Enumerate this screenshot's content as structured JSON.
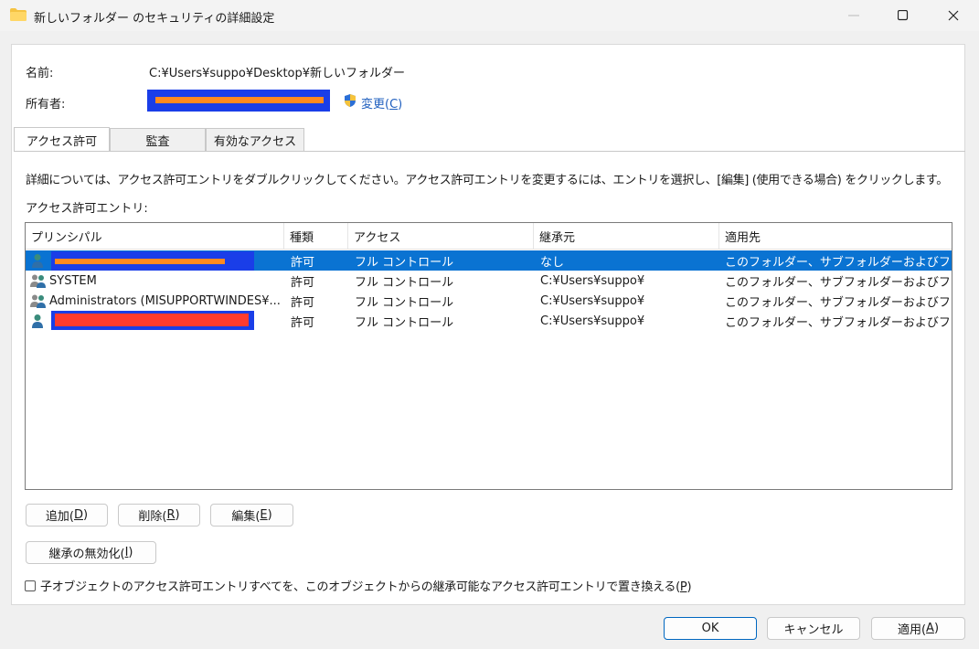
{
  "window": {
    "title": "新しいフォルダー のセキュリティの詳細設定",
    "minimize_glyph": "—",
    "maximize_glyph": "☐",
    "close_glyph": "✕"
  },
  "info": {
    "name_label": "名前:",
    "name_value": "C:¥Users¥suppo¥Desktop¥新しいフォルダー",
    "owner_label": "所有者:",
    "change_label": "変更(",
    "change_key": "C",
    "change_tail": ")"
  },
  "tabs": [
    {
      "label": "アクセス許可",
      "active": true
    },
    {
      "label": "監査",
      "active": false
    },
    {
      "label": "有効なアクセス",
      "active": false
    }
  ],
  "description": "詳細については、アクセス許可エントリをダブルクリックしてください。アクセス許可エントリを変更するには、エントリを選択し、[編集] (使用できる場合) をクリックします。",
  "entries_label": "アクセス許可エントリ:",
  "table": {
    "columns": [
      "プリンシパル",
      "種類",
      "アクセス",
      "継承元",
      "適用先"
    ],
    "rows": [
      {
        "principal": "",
        "type": "許可",
        "access": "フル コントロール",
        "inherited": "なし",
        "applies": "このフォルダー、サブフォルダーおよびファイル"
      },
      {
        "principal": "SYSTEM",
        "type": "許可",
        "access": "フル コントロール",
        "inherited": "C:¥Users¥suppo¥",
        "applies": "このフォルダー、サブフォルダーおよびファイル"
      },
      {
        "principal": "Administrators (MISUPPORTWINDES¥...",
        "type": "許可",
        "access": "フル コントロール",
        "inherited": "C:¥Users¥suppo¥",
        "applies": "このフォルダー、サブフォルダーおよびファイル"
      },
      {
        "principal": "",
        "type": "許可",
        "access": "フル コントロール",
        "inherited": "C:¥Users¥suppo¥",
        "applies": "このフォルダー、サブフォルダーおよびファイル"
      }
    ]
  },
  "buttons": {
    "add": {
      "label": "追加(",
      "key": "D",
      "tail": ")"
    },
    "remove": {
      "label": "削除(",
      "key": "R",
      "tail": ")"
    },
    "edit": {
      "label": "編集(",
      "key": "E",
      "tail": ")"
    },
    "disable_inheritance": {
      "label": "継承の無効化(",
      "key": "I",
      "tail": ")"
    },
    "ok": "OK",
    "cancel": "キャンセル",
    "apply": {
      "label": "適用(",
      "key": "A",
      "tail": ")"
    }
  },
  "replace_checkbox": {
    "label": "子オブジェクトのアクセス許可エントリすべてを、このオブジェクトからの継承可能なアクセス許可エントリで置き換える(",
    "key": "P",
    "tail": ")",
    "checked": false
  },
  "colors": {
    "selection": "#0a73d2",
    "link": "#1f5fbf",
    "redact_blue": "#1a3ee8"
  },
  "icons": [
    "folder-icon",
    "shield-icon",
    "user-icon",
    "group-icon"
  ]
}
